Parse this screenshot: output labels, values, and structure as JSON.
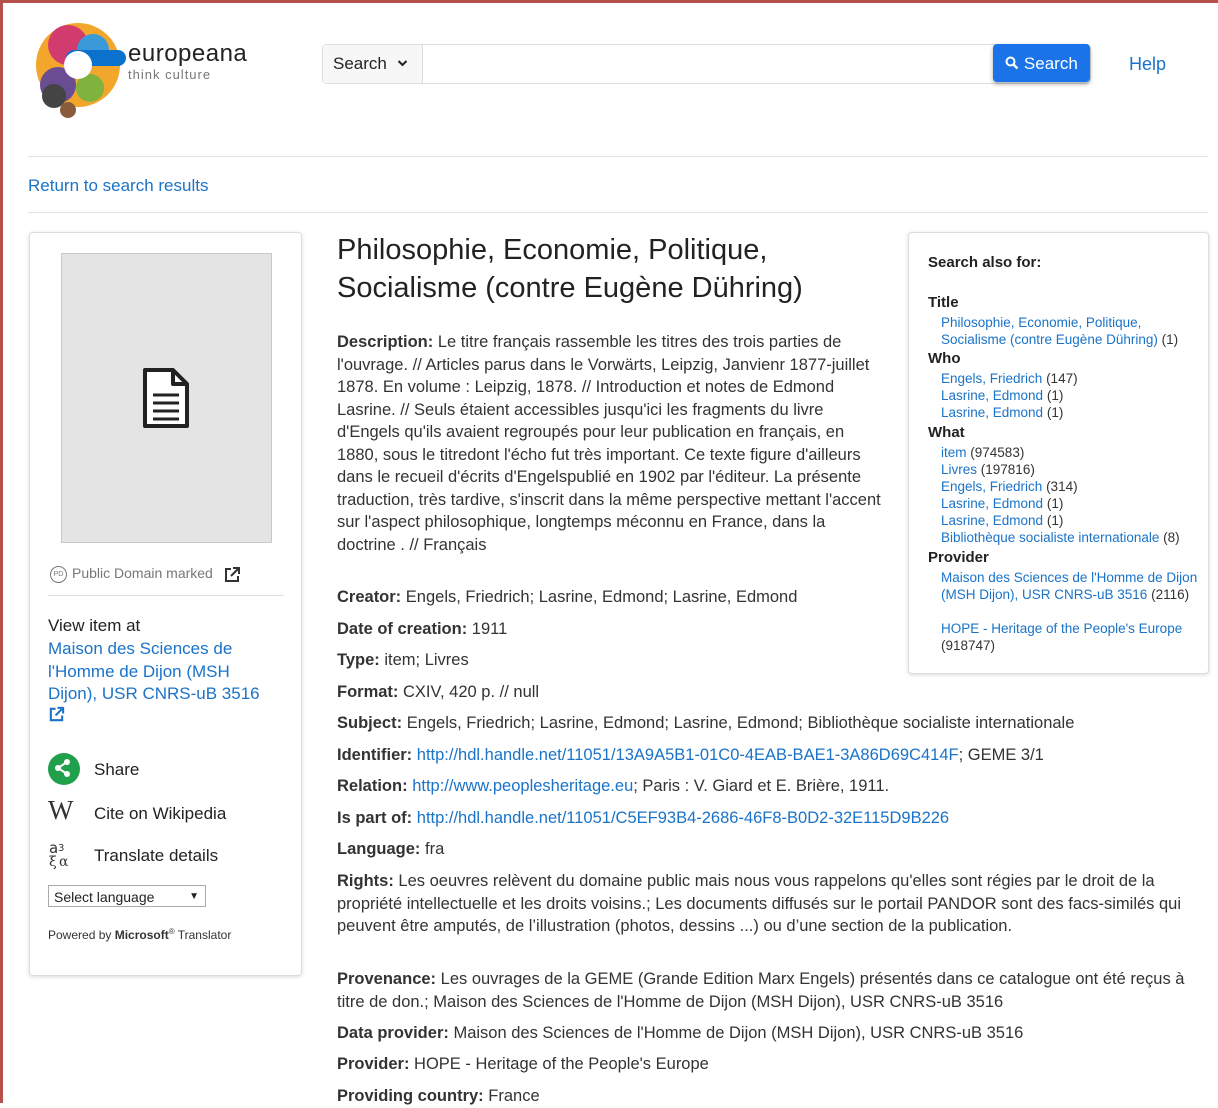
{
  "header": {
    "logo_name": "europeana",
    "logo_tagline": "think culture",
    "search_type": "Search",
    "search_placeholder": "",
    "search_button": "Search",
    "help": "Help"
  },
  "nav": {
    "back": "Return to search results"
  },
  "left": {
    "license": "Public Domain marked",
    "view_item_at": "View item at",
    "provider_link": "Maison des Sciences de l'Homme de Dijon (MSH Dijon), USR CNRS-uB 3516",
    "share": "Share",
    "cite": "Cite on Wikipedia",
    "translate": "Translate details",
    "select_language": "Select language",
    "powered_by": "Powered by",
    "microsoft": "Microsoft",
    "translator": "Translator"
  },
  "item": {
    "title": "Philosophie, Economie, Politique, Socialisme (contre Eugène Dühring)",
    "fields": {
      "description_label": "Description:",
      "description": "Le titre français rassemble les titres des trois parties de l'ouvrage. // Articles parus dans le Vorwärts, Leipzig, Janvienr 1877-juillet 1878. En volume : Leipzig, 1878. // Introduction et notes de Edmond Lasrine. // Seuls étaient accessibles jusqu'ici les fragments du livre d'Engels qu'ils avaient regroupés pour leur publication en français, en 1880, sous le titredont l'écho fut très important. Ce texte figure d'ailleurs dans le recueil d'écrits d'Engelspublié en 1902 par l'éditeur. La présente traduction, très tardive, s'inscrit dans la même perspective mettant l'accent sur l'aspect philosophique, longtemps méconnu en France, dans la doctrine . // Français",
      "creator_label": "Creator:",
      "creator": "Engels, Friedrich; Lasrine, Edmond; Lasrine, Edmond",
      "date_label": "Date of creation:",
      "date": "1911",
      "type_label": "Type:",
      "type": "item; Livres",
      "format_label": "Format:",
      "format": "CXIV, 420 p. // null",
      "subject_label": "Subject:",
      "subject": "Engels, Friedrich; Lasrine, Edmond; Lasrine, Edmond; Bibliothèque socialiste internationale",
      "identifier_label": "Identifier:",
      "identifier_link": "http://hdl.handle.net/11051/13A9A5B1-01C0-4EAB-BAE1-3A86D69C414F",
      "identifier_rest": "; GEME 3/1",
      "relation_label": "Relation:",
      "relation_link": "http://www.peoplesheritage.eu",
      "relation_rest": "; Paris : V. Giard et E. Brière, 1911.",
      "partof_label": "Is part of:",
      "partof_link": "http://hdl.handle.net/11051/C5EF93B4-2686-46F8-B0D2-32E115D9B226",
      "language_label": "Language:",
      "language": "fra",
      "rights_label": "Rights:",
      "rights": "Les oeuvres relèvent du domaine public mais nous vous rappelons qu'elles sont régies par le droit de la propriété intellectuelle et les droits voisins.; Les documents diffusés sur le portail PANDOR sont des facs-similés qui peuvent être amputés, de l’illustration (photos, dessins ...) ou d’une section de la publication.",
      "provenance_label": "Provenance:",
      "provenance": "Les ouvrages de la GEME (Grande Edition Marx Engels) présentés dans ce catalogue ont été reçus à titre de don.; Maison des Sciences de l'Homme de Dijon (MSH Dijon), USR CNRS-uB 3516",
      "dataprovider_label": "Data provider:",
      "dataprovider": "Maison des Sciences de l'Homme de Dijon (MSH Dijon), USR CNRS-uB 3516",
      "provider_label": "Provider:",
      "provider": "HOPE - Heritage of the People's Europe",
      "country_label": "Providing country:",
      "country": "France"
    }
  },
  "search_also": {
    "heading": "Search also for:",
    "title_label": "Title",
    "title_items": [
      {
        "text": "Philosophie, Economie, Politique, Socialisme (contre Eugène Dühring)",
        "count": "(1)"
      }
    ],
    "who_label": "Who",
    "who_items": [
      {
        "text": "Engels, Friedrich",
        "count": "(147)"
      },
      {
        "text": "Lasrine, Edmond",
        "count": "(1)"
      },
      {
        "text": "Lasrine, Edmond",
        "count": "(1)"
      }
    ],
    "what_label": "What",
    "what_items": [
      {
        "text": "item",
        "count": "(974583)"
      },
      {
        "text": "Livres",
        "count": "(197816)"
      },
      {
        "text": "Engels, Friedrich",
        "count": "(314)"
      },
      {
        "text": "Lasrine, Edmond",
        "count": "(1)"
      },
      {
        "text": "Lasrine, Edmond",
        "count": "(1)"
      },
      {
        "text": "Bibliothèque socialiste internationale",
        "count": "(8)"
      }
    ],
    "provider_label": "Provider",
    "provider_items": [
      {
        "text": "Maison des Sciences de l'Homme de Dijon (MSH Dijon), USR CNRS-uB 3516",
        "count": "(2116)"
      },
      {
        "text": "HOPE - Heritage of the People's Europe",
        "count": "(918747)"
      }
    ]
  },
  "colors": {
    "link": "#1a73c8",
    "search_button": "#1a73e8",
    "share_icon": "#21a04c",
    "frame": "#b5504a"
  },
  "icons": [
    "search-icon",
    "chevron-down-icon",
    "document-icon",
    "public-domain-icon",
    "external-link-icon",
    "share-icon",
    "wikipedia-icon",
    "translate-icon"
  ]
}
